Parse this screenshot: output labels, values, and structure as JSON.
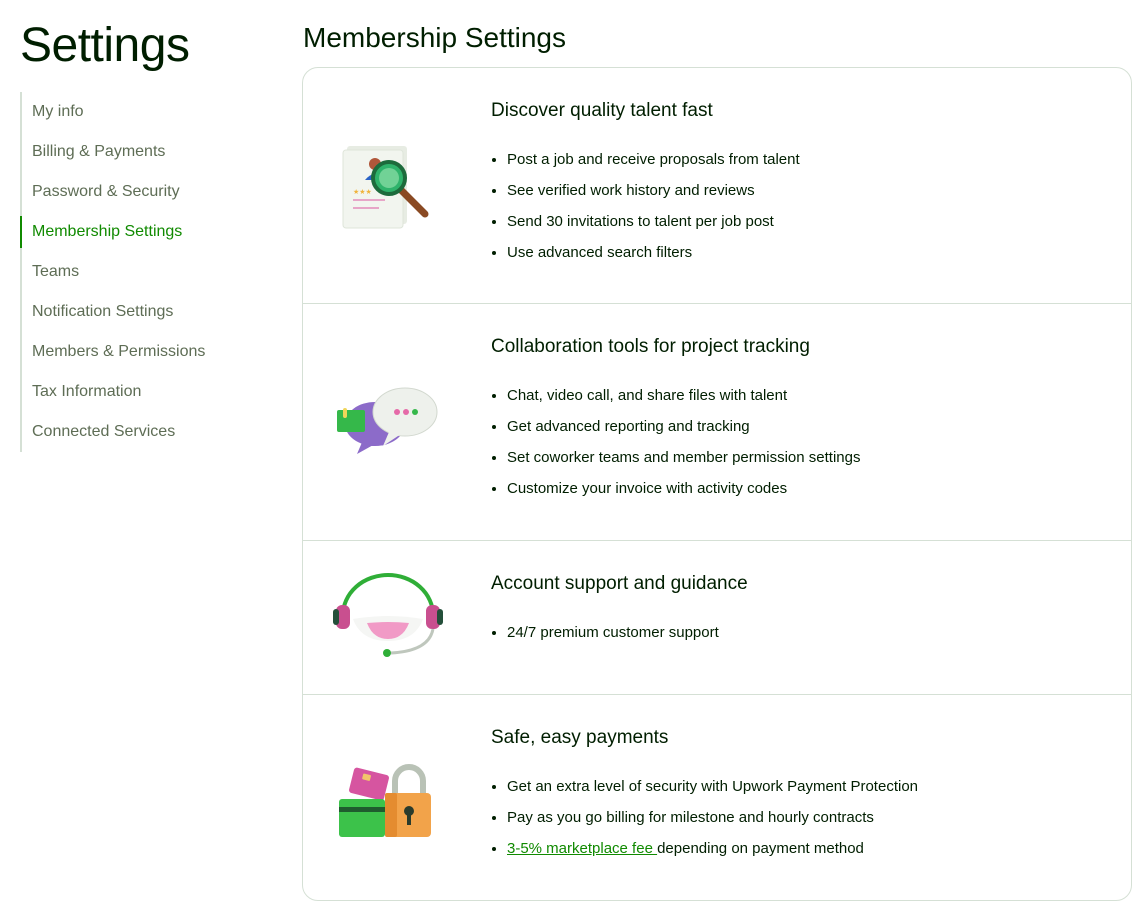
{
  "page": {
    "title": "Settings"
  },
  "sidebar": {
    "items": [
      {
        "label": "My info"
      },
      {
        "label": "Billing & Payments"
      },
      {
        "label": "Password & Security"
      },
      {
        "label": "Membership Settings",
        "active": true
      },
      {
        "label": "Teams"
      },
      {
        "label": "Notification Settings"
      },
      {
        "label": "Members & Permissions"
      },
      {
        "label": "Tax Information"
      },
      {
        "label": "Connected Services"
      }
    ]
  },
  "main": {
    "title": "Membership Settings",
    "sections": [
      {
        "icon": "talent-search-icon",
        "heading": "Discover quality talent fast",
        "bullets": [
          "Post a job and receive proposals from talent",
          "See verified work history and reviews",
          "Send 30 invitations to talent per job post",
          "Use advanced search filters"
        ]
      },
      {
        "icon": "chat-bubbles-icon",
        "heading": "Collaboration tools for project tracking",
        "bullets": [
          "Chat, video call, and share files with talent",
          "Get advanced reporting and tracking",
          "Set coworker teams and member permission settings",
          "Customize your invoice with activity codes"
        ]
      },
      {
        "icon": "headset-support-icon",
        "heading": "Account support and guidance",
        "bullets": [
          "24/7 premium customer support"
        ]
      },
      {
        "icon": "payment-lock-icon",
        "heading": "Safe, easy payments",
        "bullets": [
          "Get an extra level of security with Upwork Payment Protection",
          "Pay as you go billing for milestone and hourly contracts"
        ],
        "fee_link": "3-5% marketplace fee ",
        "fee_text": "depending on payment method"
      }
    ]
  },
  "colors": {
    "accent": "#108a00",
    "text": "#001e00",
    "muted": "#5e6d55",
    "border": "#d5e0d5"
  }
}
